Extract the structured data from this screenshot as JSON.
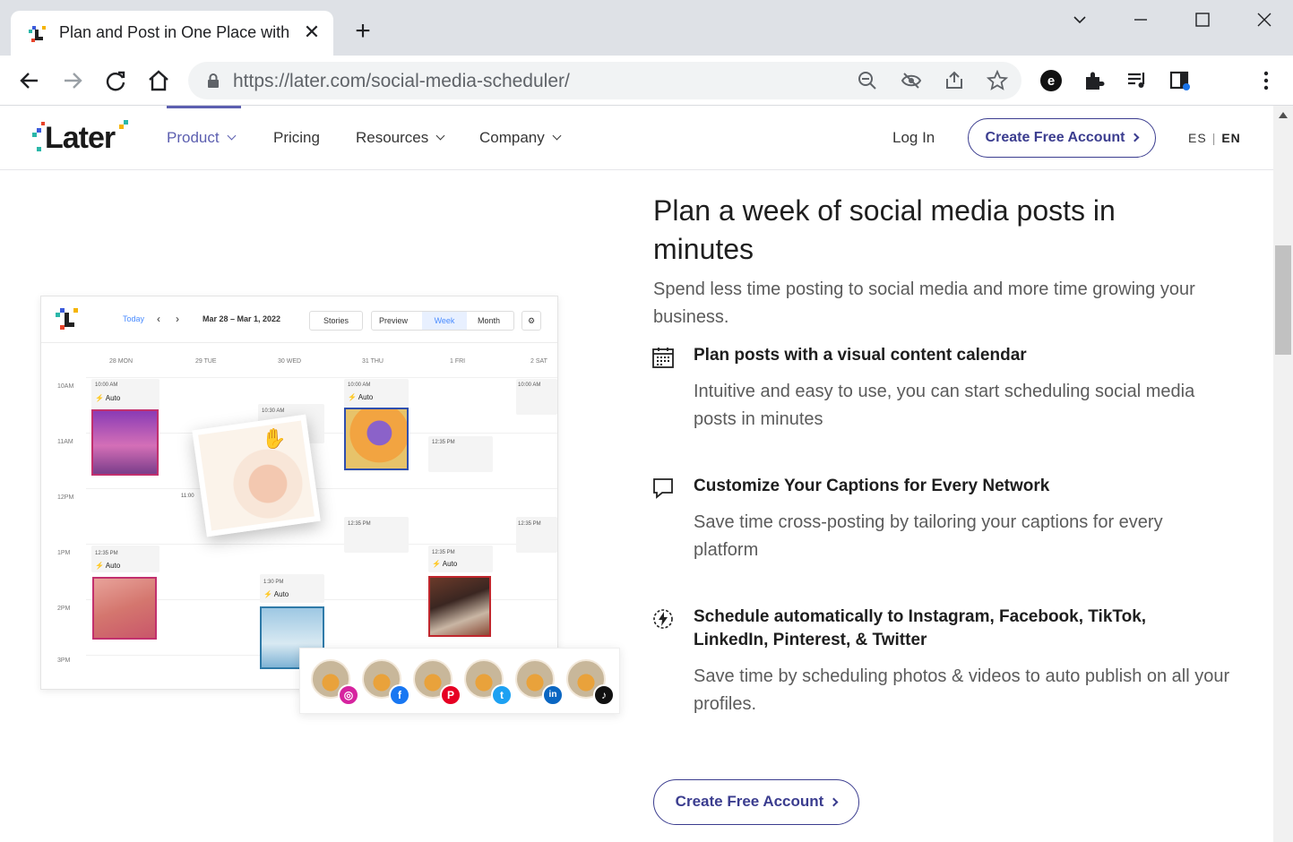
{
  "browser": {
    "tab_title": "Plan and Post in One Place with L",
    "url_host": "https://later.com",
    "url_path": "/social-media-scheduler/",
    "new_tab": "+",
    "tab_close": "✕"
  },
  "nav": {
    "logo": "Later",
    "items": [
      {
        "label": "Product"
      },
      {
        "label": "Pricing"
      },
      {
        "label": "Resources"
      },
      {
        "label": "Company"
      }
    ],
    "login": "Log In",
    "cta": "Create Free Account",
    "lang_es": "ES",
    "lang_sep": "|",
    "lang_en": "EN"
  },
  "hero": {
    "headline": "Plan a week of social media posts in minutes",
    "subhead": "Spend less time posting to social media and more time growing your business.",
    "features": [
      {
        "icon": "calendar-icon",
        "title": "Plan posts with a visual content calendar",
        "desc": "Intuitive and easy to use, you can start scheduling social media posts in minutes"
      },
      {
        "icon": "speech-bubble-icon",
        "title": "Customize Your Captions for Every Network",
        "desc": "Save time cross-posting by tailoring your captions for every platform"
      },
      {
        "icon": "auto-publish-icon",
        "title": "Schedule automatically to Instagram, Facebook, TikTok, LinkedIn, Pinterest, & Twitter",
        "desc": "Save time by scheduling photos & videos to auto publish on all your profiles."
      }
    ],
    "cta": "Create Free Account"
  },
  "calendar": {
    "today": "Today",
    "range": "Mar 28 – Mar 1, 2022",
    "stories": "Stories",
    "preview": "Preview",
    "week": "Week",
    "month": "Month",
    "days": [
      "28 MON",
      "29 TUE",
      "30 WED",
      "31 THU",
      "1 FRI",
      "2 SAT"
    ],
    "times": [
      "10AM",
      "11AM",
      "12PM",
      "1PM",
      "2PM",
      "3PM"
    ],
    "slots": [
      "10:00 AM",
      "10:30 AM",
      "10:00 AM",
      "10:00 AM",
      "12:35 PM",
      "11:00",
      "12:35 PM",
      "12:35 PM",
      "12:35 PM",
      "1:30 PM",
      "12:35 PM"
    ],
    "auto": "Auto",
    "socials": [
      {
        "name": "Instagram",
        "glyph": "◎",
        "color": "#d6249f"
      },
      {
        "name": "Facebook",
        "glyph": "f",
        "color": "#1877f2"
      },
      {
        "name": "Pinterest",
        "glyph": "P",
        "color": "#e60023"
      },
      {
        "name": "Twitter",
        "glyph": "t",
        "color": "#1da1f2"
      },
      {
        "name": "LinkedIn",
        "glyph": "in",
        "color": "#0a66c2"
      },
      {
        "name": "TikTok",
        "glyph": "♪",
        "color": "#111111"
      }
    ]
  },
  "colors": {
    "accent": "#5c5fb0",
    "cta_border": "#3b3d8f"
  }
}
